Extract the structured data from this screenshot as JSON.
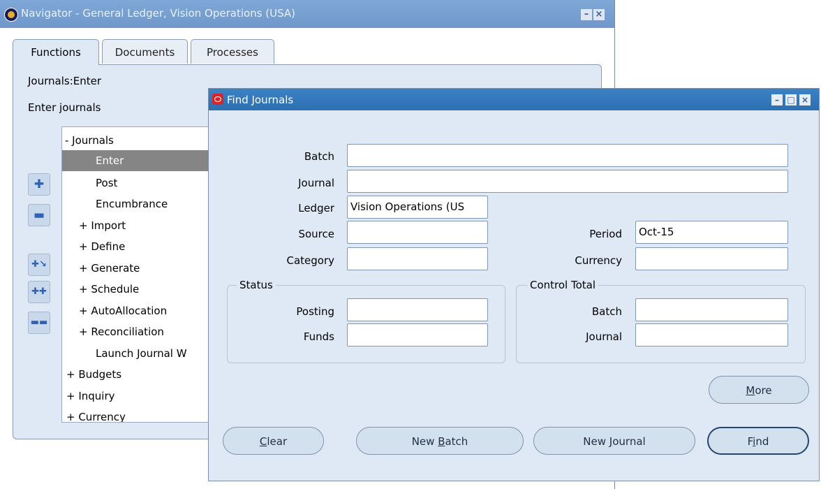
{
  "navigator": {
    "title": "Navigator - General Ledger, Vision Operations (USA)",
    "tabs": [
      {
        "label": "Functions",
        "active": true
      },
      {
        "label": "Documents",
        "active": false
      },
      {
        "label": "Processes",
        "active": false
      }
    ],
    "function_name": "Journals:Enter",
    "function_description": "Enter journals",
    "side_buttons": [
      "expand-icon",
      "collapse-icon",
      "expand-branch-icon",
      "expand-all-icon",
      "collapse-all-icon"
    ],
    "tree": [
      {
        "text": "-  Journals",
        "indent": 0,
        "selected": false
      },
      {
        "text": "Enter",
        "indent": 2,
        "selected": true
      },
      {
        "text": "Post",
        "indent": 2,
        "selected": false
      },
      {
        "text": "Encumbrance",
        "indent": 2,
        "selected": false
      },
      {
        "text": "+  Import",
        "indent": 1,
        "selected": false
      },
      {
        "text": "+  Define",
        "indent": 1,
        "selected": false
      },
      {
        "text": "+  Generate",
        "indent": 1,
        "selected": false
      },
      {
        "text": "+  Schedule",
        "indent": 1,
        "selected": false
      },
      {
        "text": "+  AutoAllocation",
        "indent": 1,
        "selected": false
      },
      {
        "text": "+  Reconciliation",
        "indent": 1,
        "selected": false
      },
      {
        "text": "Launch Journal W",
        "indent": 2,
        "selected": false
      },
      {
        "text": "+  Budgets",
        "indent": 0,
        "selected": false
      },
      {
        "text": "+  Inquiry",
        "indent": 0,
        "selected": false
      },
      {
        "text": "+  Currency",
        "indent": 0,
        "selected": false
      }
    ]
  },
  "find_journals": {
    "title": "Find Journals",
    "fields": {
      "batch": {
        "label": "Batch",
        "value": ""
      },
      "journal": {
        "label": "Journal",
        "value": ""
      },
      "ledger": {
        "label": "Ledger",
        "value": "Vision Operations (US"
      },
      "source": {
        "label": "Source",
        "value": ""
      },
      "category": {
        "label": "Category",
        "value": ""
      },
      "period": {
        "label": "Period",
        "value": "Oct-15"
      },
      "currency": {
        "label": "Currency",
        "value": ""
      }
    },
    "status": {
      "title": "Status",
      "posting_label": "Posting",
      "posting_value": "",
      "funds_label": "Funds",
      "funds_value": ""
    },
    "control_total": {
      "title": "Control Total",
      "batch_label": "Batch",
      "batch_value": "",
      "journal_label": "Journal",
      "journal_value": ""
    },
    "buttons": {
      "more_u": "M",
      "more_rest": "ore",
      "clear_u": "C",
      "clear_rest": "lear",
      "new_batch_pre": "New ",
      "new_batch_u": "B",
      "new_batch_rest": "atch",
      "new_journal_pre": "New ",
      "new_journal_u": "J",
      "new_journal_rest": "ournal",
      "find_pre": "F",
      "find_u": "i",
      "find_rest": "nd"
    }
  }
}
